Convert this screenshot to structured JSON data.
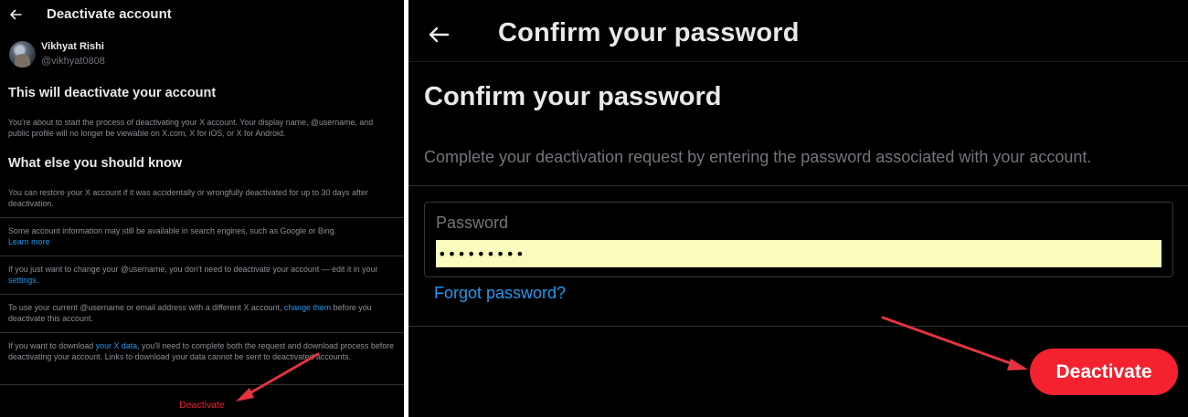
{
  "left": {
    "header": {
      "title": "Deactivate account"
    },
    "profile": {
      "name": "Vikhyat Rishi",
      "handle": "@vikhyat0808"
    },
    "heading1": "This will deactivate your account",
    "intro": "You're about to start the process of deactivating your X account. Your display name, @username, and public profile will no longer be viewable on X.com, X for iOS, or X for Android.",
    "heading2": "What else you should know",
    "items": {
      "restore": "You can restore your X account if it was accidentally or wrongfully deactivated for up to 30 days after deactivation.",
      "search_text": "Some account information may still be available in search engines, such as Google or Bing.",
      "search_link": "Learn more",
      "username_before": "If you just want to change your @username, you don't need to deactivate your account — edit it in your",
      "username_link": "settings",
      "username_after": ".",
      "email_before": "To use your current @username or email address with a different X account,",
      "email_link": "change them",
      "email_after": "before you deactivate this account.",
      "download_before": "If you want to download",
      "download_link": "your X data",
      "download_after": ", you'll need to complete both the request and download process before deactivating your account. Links to download your data cannot be sent to deactivated accounts."
    },
    "deactivate_label": "Deactivate"
  },
  "right": {
    "header": {
      "title": "Confirm your password"
    },
    "heading": "Confirm your password",
    "description": "Complete your deactivation request by entering the password associated with your account.",
    "password": {
      "label": "Password",
      "value": "•••••••••"
    },
    "forgot_label": "Forgot password?",
    "deactivate_label": "Deactivate"
  },
  "colors": {
    "background": "#000000",
    "accent_link": "#1d9bf0",
    "danger": "#f4212e",
    "annotation_arrow": "#e3343f",
    "autofill": "#fafcbb"
  },
  "icons": {
    "back": "arrow-left-icon"
  }
}
